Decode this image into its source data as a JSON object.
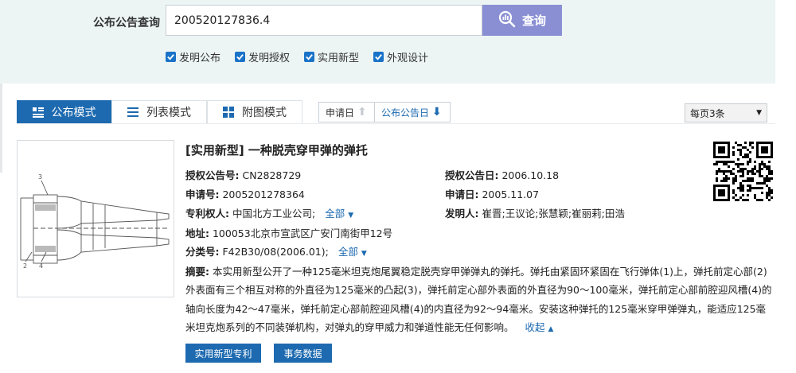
{
  "search": {
    "label": "公布公告查询",
    "query_value": "200520127836.4",
    "button_label": "查询",
    "filters": [
      {
        "label": "发明公布",
        "checked": true
      },
      {
        "label": "发明授权",
        "checked": true
      },
      {
        "label": "实用新型",
        "checked": true
      },
      {
        "label": "外观设计",
        "checked": true
      }
    ]
  },
  "toolbar": {
    "modes": [
      {
        "label": "公布模式",
        "active": true,
        "icon": "list-detail-icon"
      },
      {
        "label": "列表模式",
        "active": false,
        "icon": "list-icon"
      },
      {
        "label": "附图模式",
        "active": false,
        "icon": "grid-icon"
      }
    ],
    "sort_apply": "申请日",
    "sort_pub": "公布公告日",
    "per_page": "每页3条"
  },
  "result": {
    "title": "[实用新型] 一种脱壳穿甲弹的弹托",
    "grant_no_label": "授权公告号:",
    "grant_no": "CN2828729",
    "grant_date_label": "授权公告日:",
    "grant_date": "2006.10.18",
    "app_no_label": "申请号:",
    "app_no": "2005201278364",
    "app_date_label": "申请日:",
    "app_date": "2005.11.07",
    "patentee_label": "专利权人:",
    "patentee": "中国北方工业公司;",
    "patentee_more": "全部",
    "inventor_label": "发明人:",
    "inventors": "崔晋;王议论;张慧颖;崔丽莉;田浩",
    "address_label": "地址:",
    "address": "100053北京市宣武区广安门南街甲12号",
    "class_label": "分类号:",
    "class_no": "F42B30/08(2006.01);",
    "class_more": "全部",
    "abstract_label": "摘要:",
    "abstract_text": "本实用新型公开了一种125毫米坦克炮尾翼稳定脱壳穿甲弹弹丸的弹托。弹托由紧固环紧固在飞行弹体(1)上，弹托前定心部(2)外表面有三个相互对称的外直径为125毫米的凸起(3)，弹托前定心部外表面的外直径为90～100毫米，弹托前定心部前腔迎风槽(4)的轴向长度为42～47毫米，弹托前定心部前腔迎风槽(4)的内直径为92～94毫米。安装这种弹托的125毫米穿甲弹弹丸，能适应125毫米坦克炮系列的不同装弹机构，对弹丸的穿甲威力和弹道性能无任何影响。",
    "collapse_label": "收起",
    "btn_type": "实用新型专利",
    "btn_affair": "事务数据"
  },
  "colors": {
    "accent": "#1d6ab0",
    "search_button": "#8a8fd4",
    "search_band": "#ecf5f4"
  }
}
